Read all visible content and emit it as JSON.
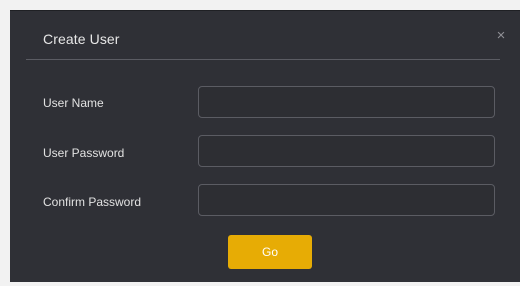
{
  "dialog": {
    "title": "Create User",
    "close_icon": "close-icon",
    "close_glyph": "×",
    "fields": [
      {
        "label": "User Name",
        "value": "",
        "placeholder": ""
      },
      {
        "label": "User Password",
        "value": "",
        "placeholder": ""
      },
      {
        "label": "Confirm Password",
        "value": "",
        "placeholder": ""
      }
    ],
    "go_label": "Go"
  },
  "colors": {
    "panel": "#2f3036",
    "field_border": "#5b5c63",
    "accent": "#e7ac05"
  }
}
